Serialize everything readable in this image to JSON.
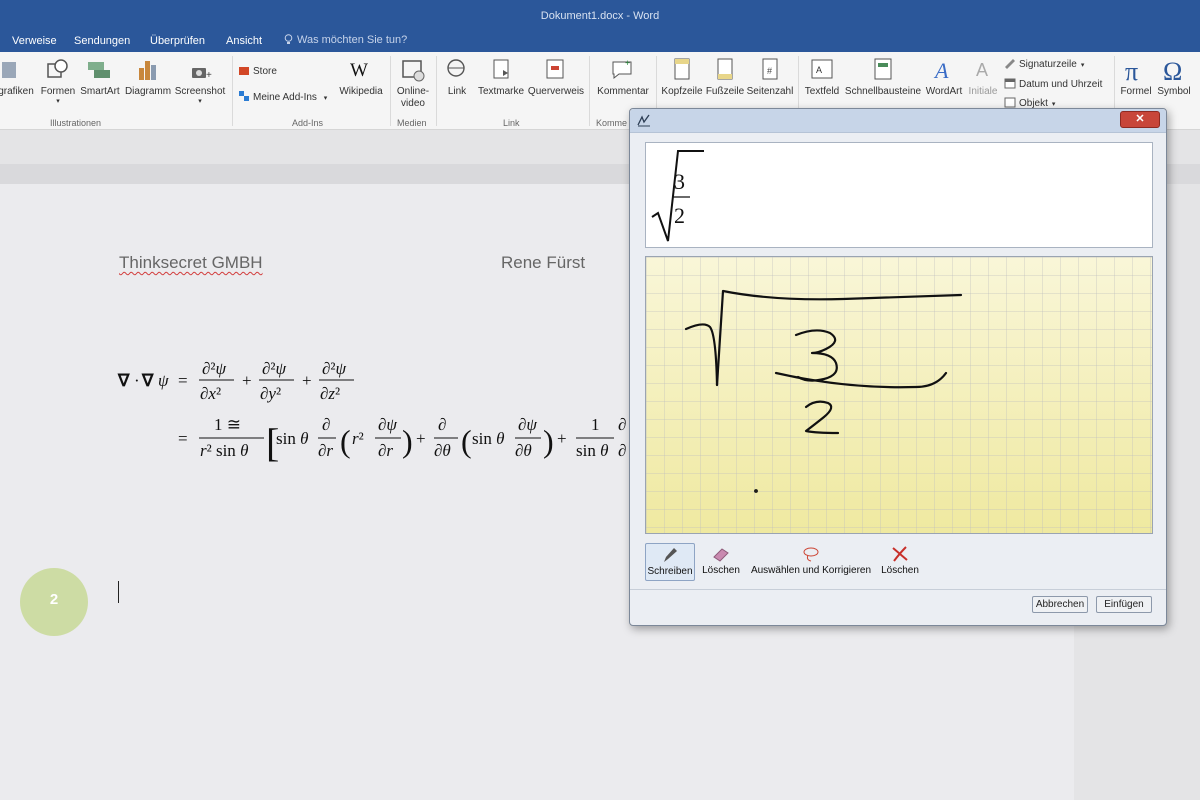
{
  "window": {
    "title": "Dokument1.docx - Word"
  },
  "tabs": [
    "Verweise",
    "Sendungen",
    "Überprüfen",
    "Ansicht"
  ],
  "tell_me": "Was möchten Sie tun?",
  "ribbon": {
    "buttons": {
      "grafiken": "grafiken",
      "formen": "Formen",
      "smartart": "SmartArt",
      "diagramm": "Diagramm",
      "screenshot": "Screenshot",
      "store": "Store",
      "meine_addins": "Meine Add-Ins",
      "wikipedia": "Wikipedia",
      "online_video_1": "Online-",
      "online_video_2": "video",
      "link": "Link",
      "textmarke": "Textmarke",
      "querverweis": "Querverweis",
      "kommentar": "Kommentar",
      "kopfzeile": "Kopfzeile",
      "fusszeile": "Fußzeile",
      "seitenzahl": "Seitenzahl",
      "textfeld": "Textfeld",
      "schnellbausteine": "Schnellbausteine",
      "wordart": "WordArt",
      "initiale": "Initiale",
      "signaturzeile": "Signaturzeile",
      "datum_uhrzeit": "Datum und Uhrzeit",
      "objekt": "Objekt",
      "formel": "Formel",
      "symbol": "Symbol"
    },
    "groups": {
      "illustrationen": "Illustrationen",
      "addins": "Add-Ins",
      "medien": "Medien",
      "link": "Link",
      "kommentare_partial": "Komme"
    }
  },
  "document": {
    "company": "Thinksecret GMBH",
    "author": "Rene Fürst",
    "page_number": "2"
  },
  "dialog": {
    "preview": {
      "numerator": "3",
      "denominator": "2"
    },
    "tools": {
      "schreiben": "Schreiben",
      "loeschen": "Löschen",
      "auswaehlen": "Auswählen und Korrigieren",
      "loeschen_alle": "Löschen"
    },
    "cancel_label": "Abbrechen",
    "insert_label": "Einfügen"
  },
  "colors": {
    "word_blue": "#2b579a",
    "grid_yellow": "#faf5c8",
    "close_red": "#c8463a"
  }
}
